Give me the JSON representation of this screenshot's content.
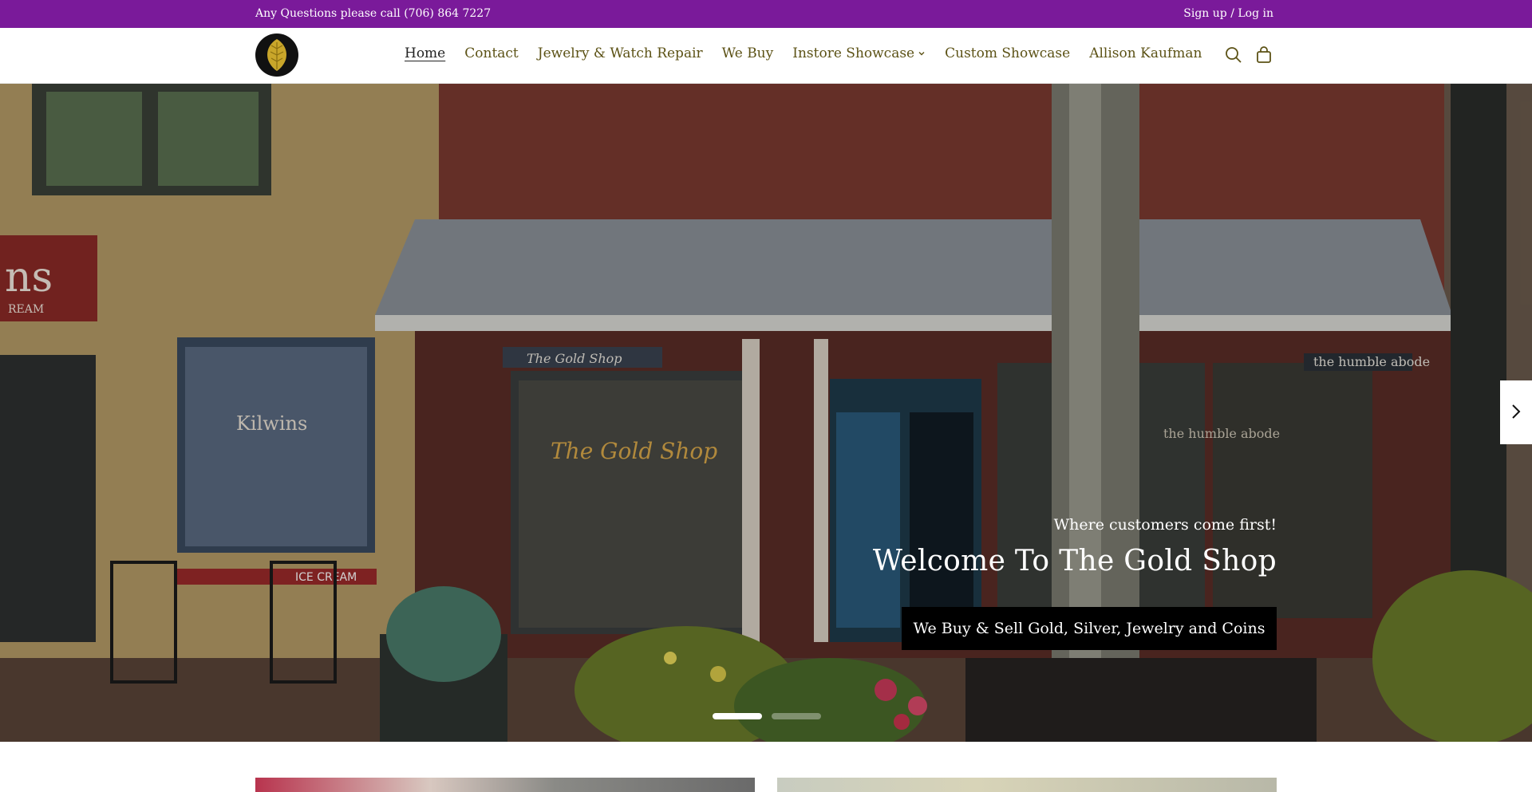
{
  "announcement": {
    "left_text": "Any Questions please call (706) 864 7227",
    "right_text": "Sign up / Log in"
  },
  "header": {
    "logo_icon": "gold-leaf-logo-icon",
    "nav": [
      {
        "label": "Home",
        "active": true
      },
      {
        "label": "Contact",
        "active": false
      },
      {
        "label": "Jewelry & Watch Repair",
        "active": false
      },
      {
        "label": "We Buy",
        "active": false
      },
      {
        "label": "Instore Showcase",
        "active": false,
        "has_dropdown": true
      },
      {
        "label": "Custom Showcase",
        "active": false
      },
      {
        "label": "Allison Kaufman",
        "active": false
      }
    ],
    "icons": [
      "search-icon",
      "shopping-bag-icon"
    ]
  },
  "hero": {
    "subtitle": "Where customers come first!",
    "title": "Welcome To The Gold Shop",
    "button_label": "We Buy & Sell Gold, Silver, Jewelry and Coins",
    "slides_total": 2,
    "active_slide": 1,
    "storefront_signs": {
      "left_sign": "ns",
      "left_sign_sub": "REAM",
      "kilwins": "Kilwins",
      "shop_sign": "The Gold Shop",
      "window_text": "The Gold Shop",
      "right_sign": "the humble abode",
      "right_window": "the humble abode",
      "ice_cream": "ICE CREAM"
    }
  },
  "colors": {
    "announcement_bg": "#7a1a9a",
    "nav_text": "#5c5216",
    "button_bg": "#000000"
  }
}
